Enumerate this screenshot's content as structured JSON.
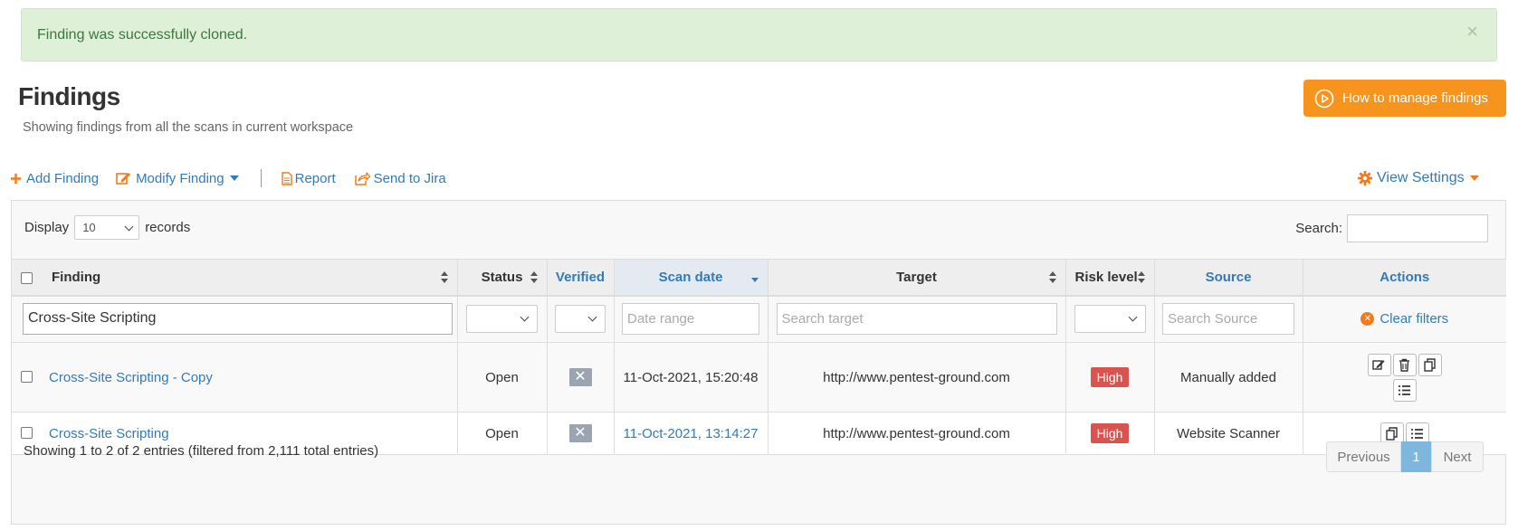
{
  "alert": {
    "message": "Finding was successfully cloned.",
    "close": "×"
  },
  "page": {
    "title": "Findings",
    "subtitle": "Showing findings from all the scans in current workspace",
    "help_button": "How to manage findings"
  },
  "toolbar": {
    "add": "Add Finding",
    "modify": "Modify Finding",
    "report": "Report",
    "jira": "Send to Jira",
    "view_settings": "View Settings"
  },
  "table_controls": {
    "display_label": "Display",
    "display_value": "10",
    "records_label": "records",
    "search_label": "Search:",
    "search_value": ""
  },
  "columns": {
    "finding": "Finding",
    "status": "Status",
    "verified": "Verified",
    "scan_date": "Scan date",
    "target": "Target",
    "risk_level": "Risk level",
    "source": "Source",
    "actions": "Actions"
  },
  "filters": {
    "finding_value": "Cross-Site Scripting",
    "date_placeholder": "Date range",
    "target_placeholder": "Search target",
    "source_placeholder": "Search Source",
    "clear": "Clear filters"
  },
  "rows": [
    {
      "finding": "Cross-Site Scripting - Copy",
      "status": "Open",
      "verified": "✕",
      "scan_date": "11-Oct-2021, 15:20:48",
      "target": "http://www.pentest-ground.com",
      "risk": "High",
      "source": "Manually added"
    },
    {
      "finding": "Cross-Site Scripting",
      "status": "Open",
      "verified": "✕",
      "scan_date": "11-Oct-2021, 13:14:27",
      "target": "http://www.pentest-ground.com",
      "risk": "High",
      "source": "Website Scanner"
    }
  ],
  "footer": {
    "info": "Showing 1 to 2 of 2 entries (filtered from 2,111 total entries)",
    "previous": "Previous",
    "current_page": "1",
    "next": "Next"
  },
  "colors": {
    "accent_orange": "#f7941d",
    "link_blue": "#337ab7",
    "alert_green_bg": "#dff0d8",
    "risk_high": "#d9534f"
  },
  "icons": [
    "close-icon",
    "play-circle-icon",
    "plus-icon",
    "edit-icon",
    "document-icon",
    "share-icon",
    "gear-icon",
    "sort-icon",
    "chevron-down-icon",
    "x-circle-icon",
    "trash-icon",
    "copy-icon",
    "list-icon"
  ]
}
